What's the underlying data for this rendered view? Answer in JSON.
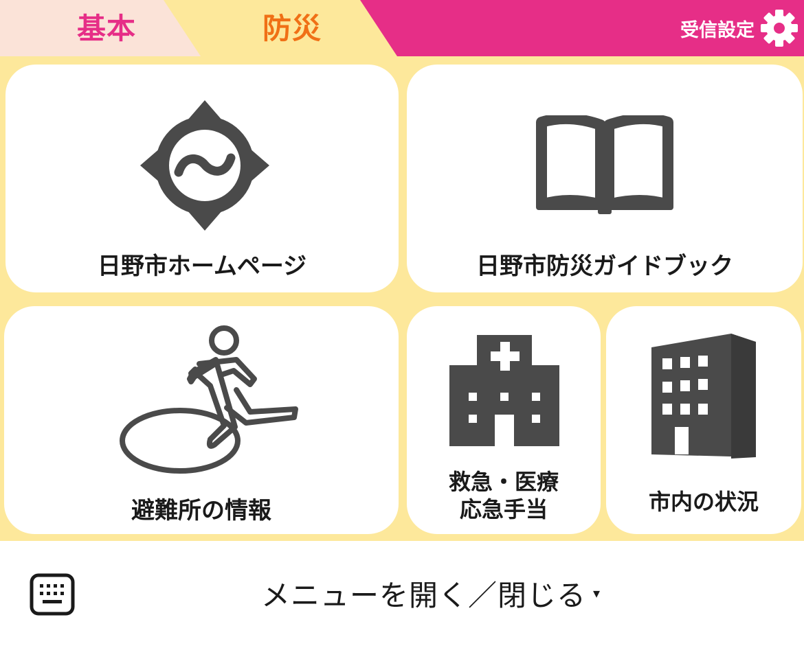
{
  "colors": {
    "header_pink": "#e62e87",
    "tab_basic_bg": "#fbe3d8",
    "tab_active_bg": "#fde89b",
    "tab_basic_text": "#e62e87",
    "tab_active_text": "#f07016",
    "panel_bg": "#fde89b",
    "icon_gray": "#4a4a4a"
  },
  "header": {
    "tabs": [
      {
        "label": "基本",
        "active": false
      },
      {
        "label": "防災",
        "active": true
      }
    ],
    "settings_label": "受信設定",
    "settings_icon": "gear-icon"
  },
  "tiles": [
    {
      "label": "日野市ホームページ",
      "icon": "compass-icon"
    },
    {
      "label": "日野市防災ガイドブック",
      "icon": "open-book-icon"
    },
    {
      "label": "避難所の情報",
      "icon": "evacuation-icon"
    },
    {
      "label_line1": "救急・医療",
      "label_line2": "応急手当",
      "icon": "hospital-icon"
    },
    {
      "label": "市内の状況",
      "icon": "building-icon"
    }
  ],
  "bottom_bar": {
    "keyboard_icon": "keyboard-icon",
    "menu_toggle_label": "メニューを開く／閉じる",
    "caret": "▾"
  }
}
